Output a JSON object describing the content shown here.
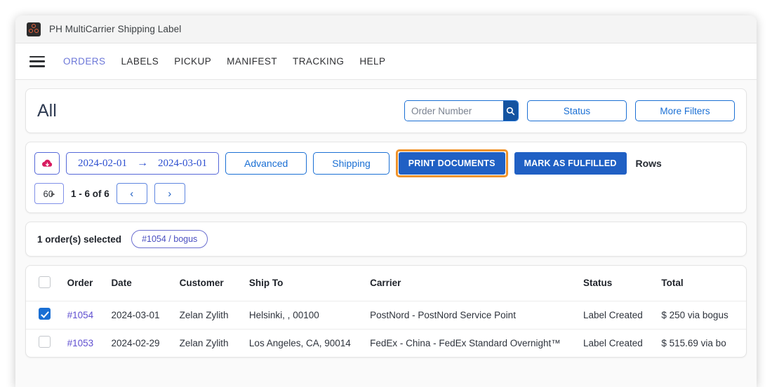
{
  "window": {
    "title": "PH MultiCarrier Shipping Label",
    "logo_icon": "hexagon-molecule-icon"
  },
  "nav": {
    "menu_icon": "hamburger-menu-icon",
    "items": [
      {
        "label": "ORDERS",
        "active": true
      },
      {
        "label": "LABELS",
        "active": false
      },
      {
        "label": "PICKUP",
        "active": false
      },
      {
        "label": "MANIFEST",
        "active": false
      },
      {
        "label": "TRACKING",
        "active": false
      },
      {
        "label": "HELP",
        "active": false
      }
    ]
  },
  "header": {
    "title": "All",
    "search": {
      "placeholder": "Order Number",
      "value": "",
      "button_icon": "search-icon"
    },
    "status_button": "Status",
    "more_filters_button": "More Filters"
  },
  "toolbar": {
    "export_icon": "cloud-download-icon",
    "date_from": "2024-02-01",
    "date_arrow": "→",
    "date_to": "2024-03-01",
    "advanced_button": "Advanced",
    "shipping_button": "Shipping",
    "print_documents_button": "PRINT DOCUMENTS",
    "mark_as_fulfilled_button": "MARK AS FULFILLED",
    "rows_label": "Rows",
    "rows_per_page": "60",
    "rows_chevron_icon": "chevron-down-icon",
    "page_range": "1 - 6 of 6",
    "prev_icon": "chevron-left-icon",
    "next_icon": "chevron-right-icon"
  },
  "selection": {
    "text": "1 order(s) selected",
    "chips": [
      "#1054 / bogus"
    ]
  },
  "table": {
    "columns": [
      "Order",
      "Date",
      "Customer",
      "Ship To",
      "Carrier",
      "Status",
      "Total"
    ],
    "rows": [
      {
        "checked": true,
        "order": "#1054",
        "date": "2024-03-01",
        "customer": "Zelan Zylith",
        "ship_to": "Helsinki, , 00100",
        "carrier": "PostNord - PostNord Service Point",
        "status": "Label Created",
        "total": "$ 250 via bogus"
      },
      {
        "checked": false,
        "order": "#1053",
        "date": "2024-02-29",
        "customer": "Zelan Zylith",
        "ship_to": "Los Angeles, CA, 90014",
        "carrier": "FedEx - China - FedEx Standard Overnight™",
        "status": "Label Created",
        "total": "$ 515.69 via bo"
      }
    ]
  },
  "colors": {
    "primary_blue": "#1a6fd4",
    "dark_blue": "#2060c4",
    "focus_orange": "#f0932b",
    "link_purple": "#5f4fd0",
    "logo_orange": "#e8603c"
  }
}
